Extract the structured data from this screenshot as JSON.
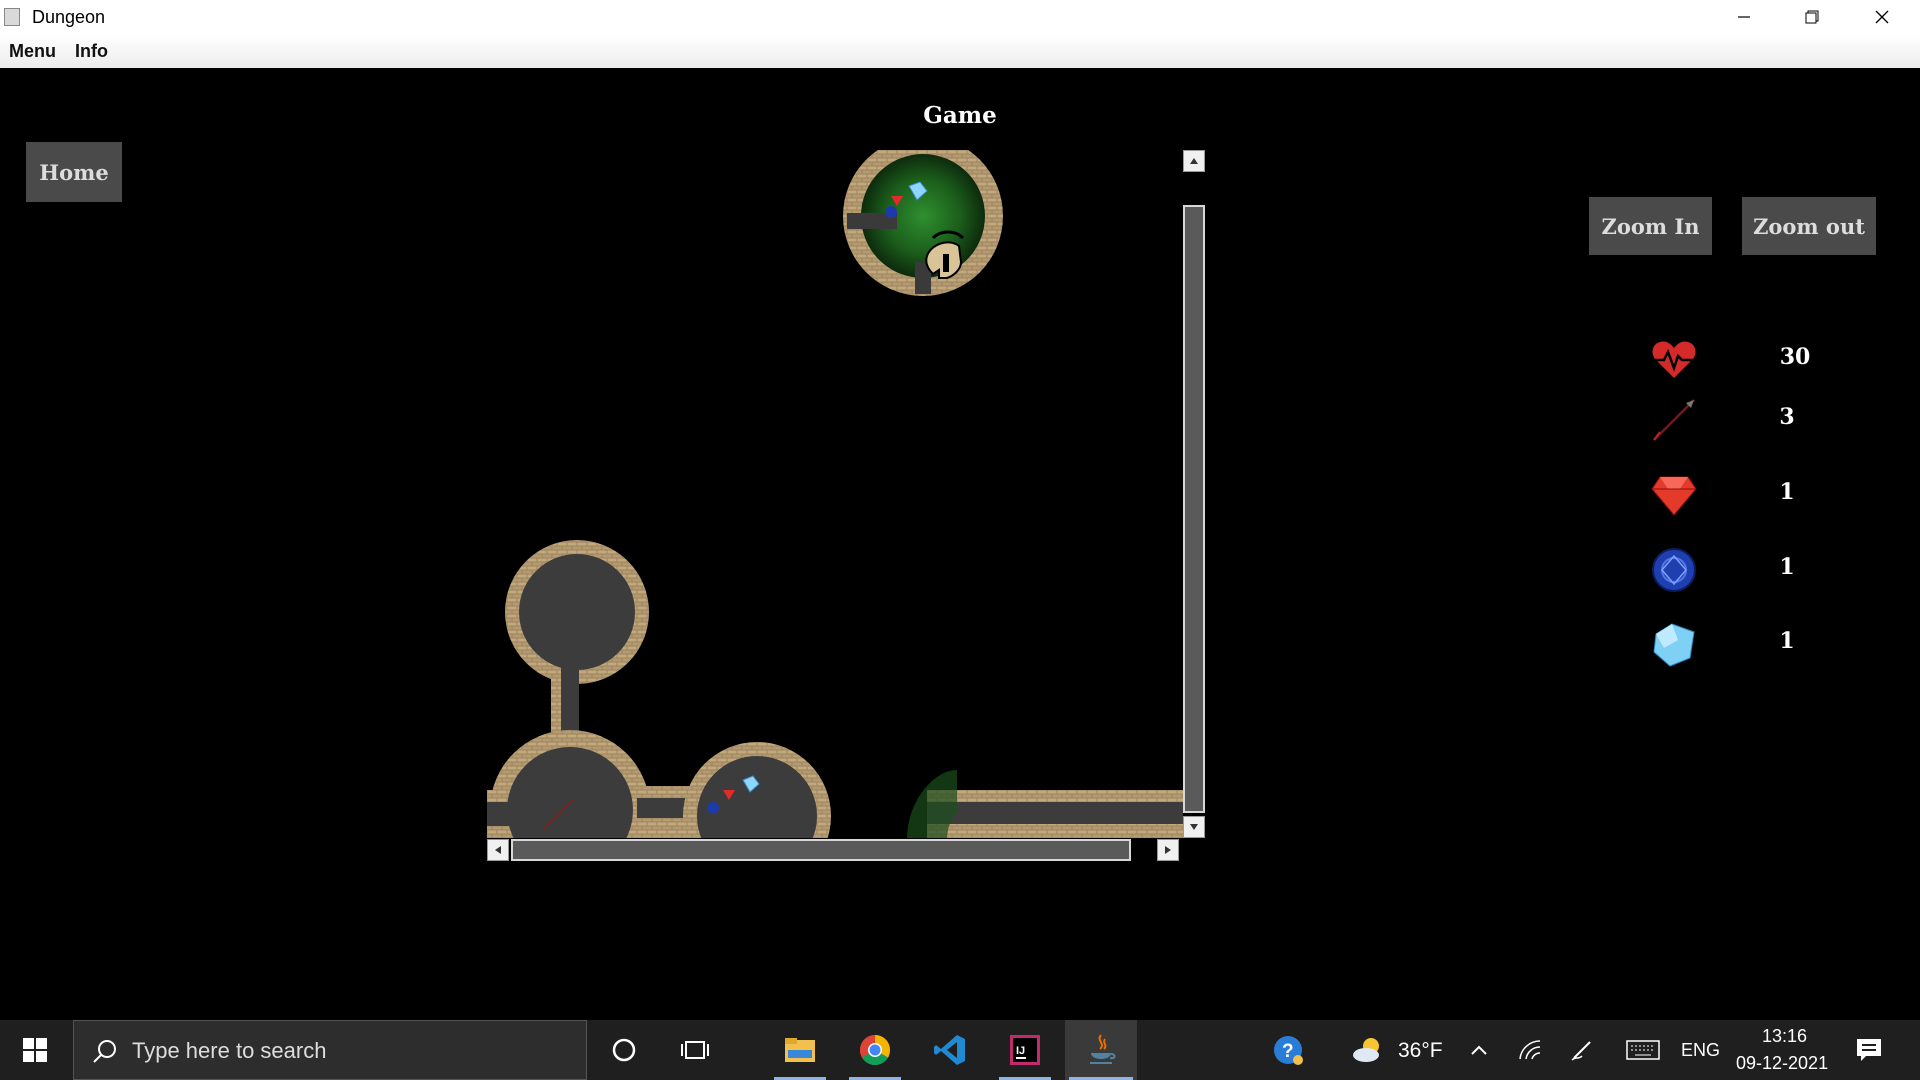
{
  "window": {
    "title": "Dungeon"
  },
  "menubar": {
    "items": [
      "Menu",
      "Info"
    ]
  },
  "game": {
    "title": "Game",
    "home_button": "Home",
    "zoom_in_button": "Zoom In",
    "zoom_out_button": "Zoom out"
  },
  "stats": [
    {
      "icon": "heart-health-icon",
      "value": "30"
    },
    {
      "icon": "arrow-icon",
      "value": "3"
    },
    {
      "icon": "ruby-icon",
      "value": "1"
    },
    {
      "icon": "sapphire-icon",
      "value": "1"
    },
    {
      "icon": "diamond-icon",
      "value": "1"
    }
  ],
  "taskbar": {
    "search_placeholder": "Type here to search",
    "weather": "36°F",
    "language": "ENG",
    "time": "13:16",
    "date": "09-12-2021",
    "apps": [
      "file-explorer",
      "chrome",
      "vscode",
      "intellij",
      "java"
    ]
  },
  "colors": {
    "background": "#000000",
    "button": "#4a4a4a",
    "taskbar": "#1f1f1f",
    "tunnel": "#3c3c3c",
    "wall": "#b49a6e"
  }
}
